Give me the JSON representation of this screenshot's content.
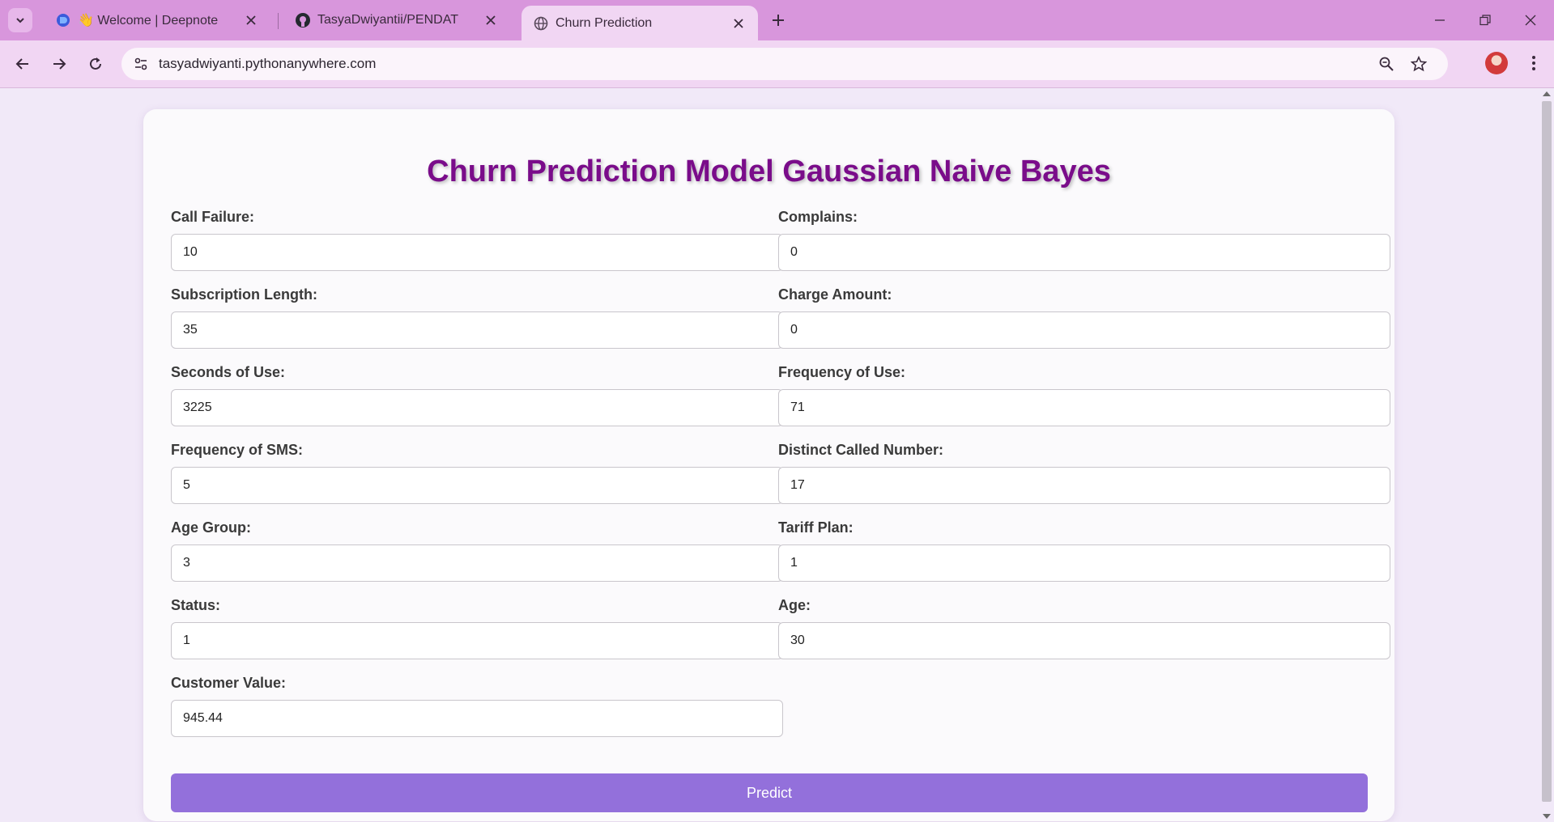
{
  "browser": {
    "tabs": [
      {
        "title": "👋 Welcome | Deepnote",
        "favicon": "deepnote-icon",
        "active": false
      },
      {
        "title": "TasyaDwiyantii/PENDAT",
        "favicon": "github-icon",
        "active": false
      },
      {
        "title": "Churn Prediction",
        "favicon": "globe-icon",
        "active": true
      }
    ],
    "url": "tasyadwiyanti.pythonanywhere.com"
  },
  "page": {
    "heading": "Churn Prediction Model Gaussian Naive Bayes",
    "fields": [
      {
        "label": "Call Failure:",
        "value": "10"
      },
      {
        "label": "Complains:",
        "value": "0"
      },
      {
        "label": "Subscription Length:",
        "value": "35"
      },
      {
        "label": "Charge Amount:",
        "value": "0"
      },
      {
        "label": "Seconds of Use:",
        "value": "3225"
      },
      {
        "label": "Frequency of Use:",
        "value": "71"
      },
      {
        "label": "Frequency of SMS:",
        "value": "5"
      },
      {
        "label": "Distinct Called Number:",
        "value": "17"
      },
      {
        "label": "Age Group:",
        "value": "3"
      },
      {
        "label": "Tariff Plan:",
        "value": "1"
      },
      {
        "label": "Status:",
        "value": "1"
      },
      {
        "label": "Age:",
        "value": "30"
      },
      {
        "label": "Customer Value:",
        "value": "945.44"
      }
    ],
    "predict_label": "Predict"
  },
  "colors": {
    "heading": "#7a0c8a",
    "button": "#9370db",
    "tabstrip": "#d896dc",
    "toolbar": "#f1d6f3"
  }
}
